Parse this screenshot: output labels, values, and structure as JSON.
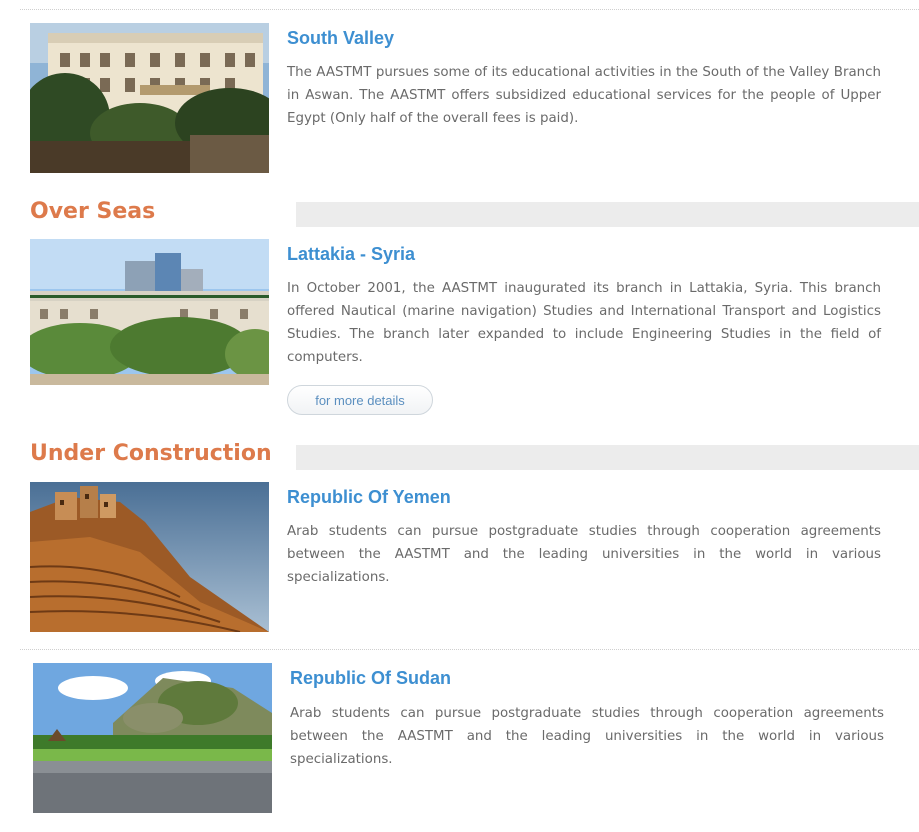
{
  "entries": [
    {
      "title": "South Valley",
      "description": "The AASTMT pursues some of its educational activities in the South of the Valley Branch in Aswan. The AASTMT offers subsidized educational services for the people of Upper Egypt (Only half of the overall fees is paid)."
    },
    {
      "title": "Lattakia - Syria",
      "description": "In October 2001, the AASTMT inaugurated its branch in Lattakia, Syria. This branch offered Nautical (marine navigation) Studies and International Transport and Logistics Studies. The branch later expanded to include Engineering Studies in the field of computers."
    },
    {
      "title": "Republic Of Yemen",
      "description": "Arab students can pursue postgraduate studies through cooperation agreements between the AASTMT and the leading universities in the world in various specializations."
    },
    {
      "title": "Republic Of Sudan",
      "description": "Arab students can pursue postgraduate studies through cooperation agreements between the AASTMT and the leading universities in the world in various specializations."
    }
  ],
  "sections": {
    "overseas": "Over Seas",
    "under_construction": "Under Construction"
  },
  "more_button_label": "for more details",
  "colors": {
    "title_blue": "#3d8fd1",
    "heading_orange": "#dd7a4b",
    "body_text": "#6a6a6a",
    "section_bar": "#ececec"
  }
}
